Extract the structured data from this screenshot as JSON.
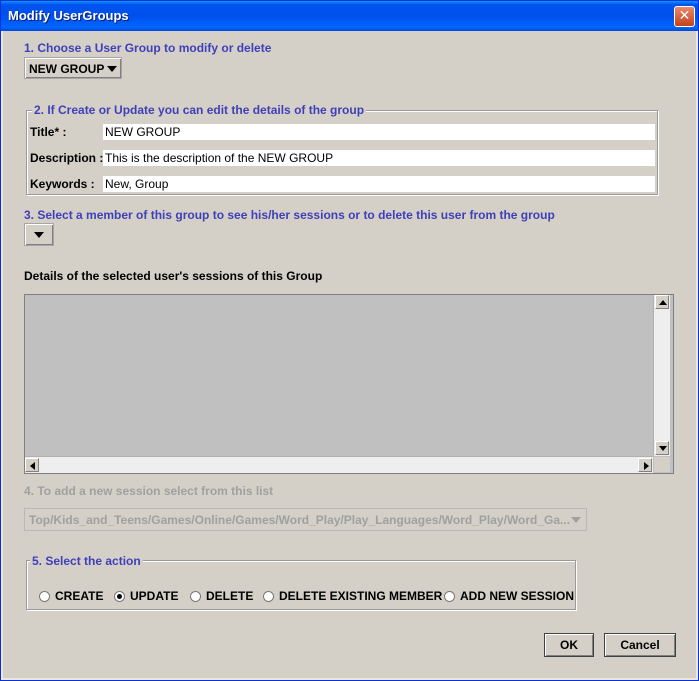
{
  "window": {
    "title": "Modify UserGroups",
    "close_label": "✕"
  },
  "step1": {
    "label": "1. Choose a User Group to modify or delete",
    "selected_group": "NEW GROUP"
  },
  "step2": {
    "legend": "2. If Create or Update you can edit the details of the group",
    "title_label": "Title* :",
    "title_value": "NEW GROUP",
    "description_label": "Description :",
    "description_value": "This is the description of the NEW GROUP",
    "keywords_label": "Keywords :",
    "keywords_value": "New, Group"
  },
  "step3": {
    "label": "3. Select a member of this group to see his/her sessions or to delete this user from the group",
    "selected_member": ""
  },
  "sessions": {
    "label": "Details of the selected user's sessions of this Group"
  },
  "step4": {
    "label": "4. To add a new session select from this list",
    "selected_session": "Top/Kids_and_Teens/Games/Online/Games/Word_Play/Play_Languages/Word_Play/Word_Ga..."
  },
  "step5": {
    "legend": "5. Select the action",
    "options": [
      {
        "label": "CREATE",
        "checked": false
      },
      {
        "label": "UPDATE",
        "checked": true
      },
      {
        "label": "DELETE",
        "checked": false
      },
      {
        "label": "DELETE EXISTING MEMBER",
        "checked": false
      },
      {
        "label": "ADD NEW SESSION",
        "checked": false
      }
    ]
  },
  "buttons": {
    "ok": "OK",
    "cancel": "Cancel"
  },
  "colors": {
    "titlebar": "#0053ee",
    "section_label": "#3f3fb8",
    "disabled_text": "#a0a0a0",
    "panel": "#d4d0c8"
  }
}
